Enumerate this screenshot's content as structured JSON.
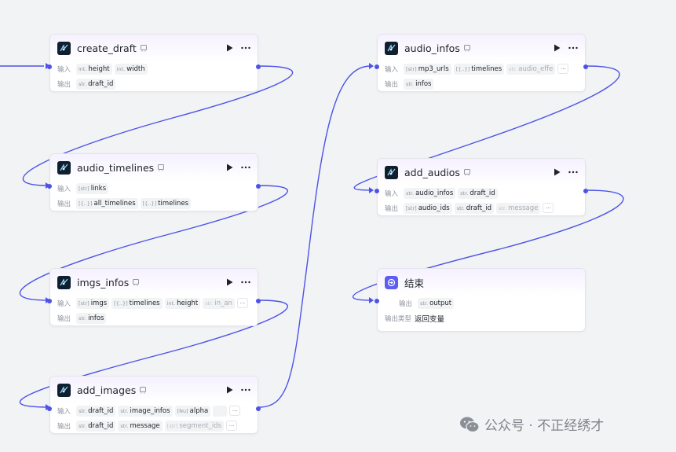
{
  "labels": {
    "input": "输入",
    "output": "输出",
    "output_type": "输出类型"
  },
  "nodes": {
    "create_draft": {
      "title": "create_draft",
      "inputs": [
        {
          "type": "int.",
          "name": "height"
        },
        {
          "type": "int.",
          "name": "width"
        }
      ],
      "outputs": [
        {
          "type": "str.",
          "name": "draft_id"
        }
      ]
    },
    "audio_timelines": {
      "title": "audio_timelines",
      "inputs": [
        {
          "type": "[str]",
          "name": "links"
        }
      ],
      "outputs": [
        {
          "type": "[{..}]",
          "name": "all_timelines"
        },
        {
          "type": "[{..}]",
          "name": "timelines"
        }
      ]
    },
    "imgs_infos": {
      "title": "imgs_infos",
      "inputs": [
        {
          "type": "[str]",
          "name": "imgs"
        },
        {
          "type": "[{..}]",
          "name": "timelines"
        },
        {
          "type": "int.",
          "name": "height"
        },
        {
          "type": "str.",
          "name": "in_an"
        }
      ],
      "outputs": [
        {
          "type": "str.",
          "name": "infos"
        }
      ],
      "more": "···"
    },
    "add_images": {
      "title": "add_images",
      "inputs": [
        {
          "type": "str.",
          "name": "draft_id"
        },
        {
          "type": "str.",
          "name": "image_infos"
        },
        {
          "type": "[Nu]",
          "name": "alpha"
        },
        {
          "type": "",
          "name": ""
        }
      ],
      "outputs": [
        {
          "type": "str.",
          "name": "draft_id"
        },
        {
          "type": "str.",
          "name": "message"
        },
        {
          "type": "[str]",
          "name": "segment_ids"
        }
      ],
      "more": "···"
    },
    "audio_infos": {
      "title": "audio_infos",
      "inputs": [
        {
          "type": "[str]",
          "name": "mp3_urls"
        },
        {
          "type": "[{..}]",
          "name": "timelines"
        },
        {
          "type": "str.",
          "name": "audio_effe"
        }
      ],
      "outputs": [
        {
          "type": "str.",
          "name": "infos"
        }
      ],
      "more": "···"
    },
    "add_audios": {
      "title": "add_audios",
      "inputs": [
        {
          "type": "str.",
          "name": "audio_infos"
        },
        {
          "type": "str.",
          "name": "draft_id"
        }
      ],
      "outputs": [
        {
          "type": "[str]",
          "name": "audio_ids"
        },
        {
          "type": "str.",
          "name": "draft_id"
        },
        {
          "type": "str.",
          "name": "message"
        }
      ],
      "more": "···"
    },
    "end": {
      "title": "结束",
      "outputs": [
        {
          "type": "str.",
          "name": "output"
        }
      ],
      "output_type": "返回变量"
    }
  },
  "icons": {
    "plugin": "plugin-icon",
    "end": "exit-icon",
    "fold": "fold-icon",
    "run": "play-icon",
    "more": "more-icon"
  },
  "colors": {
    "edge": "#4d53e8",
    "canvas": "#f2f3f5"
  },
  "watermark": {
    "text": "公众号 · 不正经绣才"
  }
}
